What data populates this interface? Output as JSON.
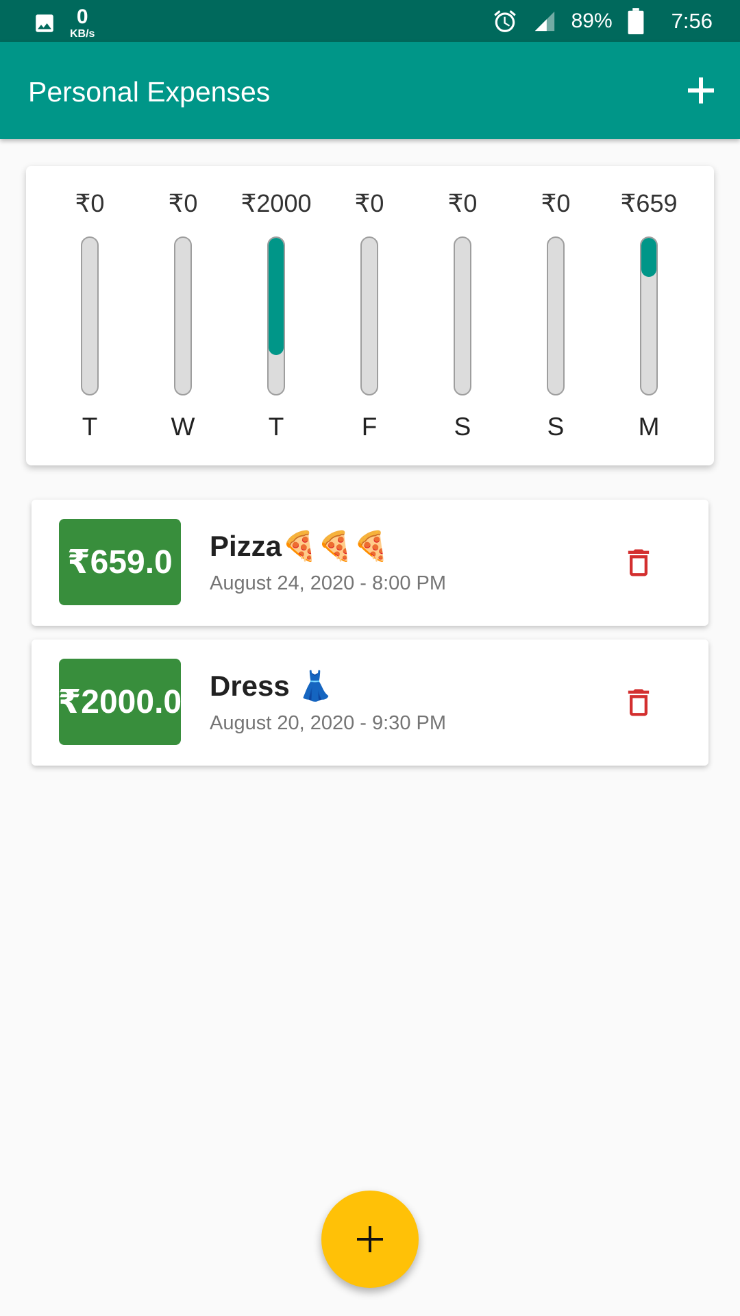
{
  "status_bar": {
    "net_speed": "0",
    "net_unit": "KB/s",
    "battery": "89%",
    "time": "7:56",
    "icons": [
      "image-icon",
      "alarm-icon",
      "signal-icon",
      "battery-icon"
    ]
  },
  "app_bar": {
    "title": "Personal Expenses",
    "add_icon": "plus-icon"
  },
  "chart": {
    "bars": [
      {
        "day": "T",
        "amount": "₹0",
        "fraction": 0
      },
      {
        "day": "W",
        "amount": "₹0",
        "fraction": 0
      },
      {
        "day": "T",
        "amount": "₹2000",
        "fraction": 0.752
      },
      {
        "day": "F",
        "amount": "₹0",
        "fraction": 0
      },
      {
        "day": "S",
        "amount": "₹0",
        "fraction": 0
      },
      {
        "day": "S",
        "amount": "₹0",
        "fraction": 0
      },
      {
        "day": "M",
        "amount": "₹659",
        "fraction": 0.248
      }
    ],
    "fill_color": "#009688"
  },
  "transactions": [
    {
      "amount": "₹659.0",
      "title": "Pizza🍕🍕🍕",
      "date": "August 24, 2020 - 8:00 PM",
      "delete_icon": "trash-icon"
    },
    {
      "amount": "₹2000.0",
      "title": "Dress 👗",
      "date": "August 20, 2020 - 9:30 PM",
      "delete_icon": "trash-icon"
    }
  ],
  "fab": {
    "icon": "plus-icon",
    "color": "#ffc107"
  },
  "colors": {
    "primary": "#009688",
    "primary_dark": "#00695c",
    "amount_bg": "#388e3c",
    "delete": "#d32f2f"
  }
}
